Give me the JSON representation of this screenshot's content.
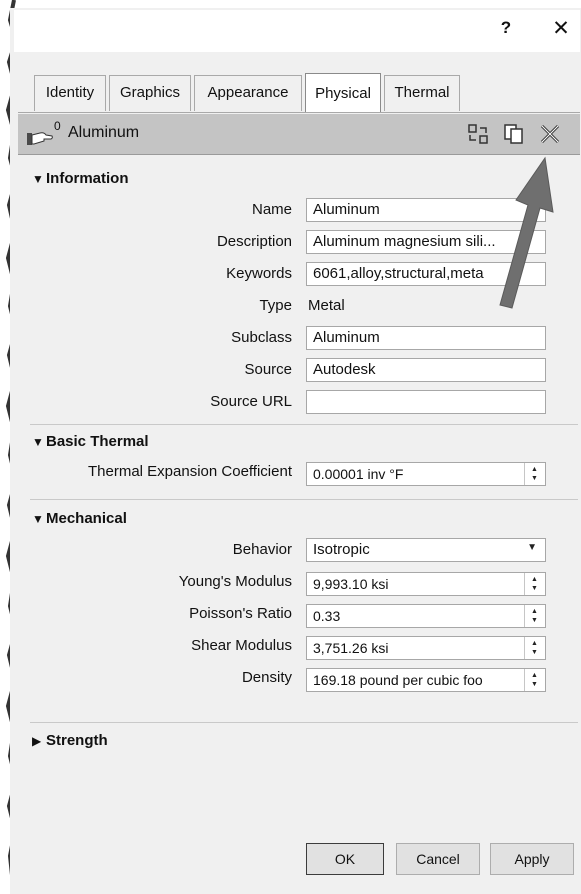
{
  "titlebar": {
    "help_label": "?",
    "close_label": "✕"
  },
  "tabs": [
    {
      "label": "Identity"
    },
    {
      "label": "Graphics"
    },
    {
      "label": "Appearance"
    },
    {
      "label": "Physical"
    },
    {
      "label": "Thermal"
    }
  ],
  "active_tab": "Physical",
  "material": {
    "count": "0",
    "name": "Aluminum",
    "icons": [
      "replace-asset-icon",
      "duplicate-asset-icon",
      "remove-asset-icon"
    ]
  },
  "information": {
    "heading": "Information",
    "name_label": "Name",
    "name_value": "Aluminum",
    "description_label": "Description",
    "description_value": "Aluminum magnesium sili...",
    "keywords_label": "Keywords",
    "keywords_value": "6061,alloy,structural,meta",
    "type_label": "Type",
    "type_value": "Metal",
    "subclass_label": "Subclass",
    "subclass_value": "Aluminum",
    "source_label": "Source",
    "source_value": "Autodesk",
    "source_url_label": "Source URL",
    "source_url_value": ""
  },
  "basic_thermal": {
    "heading": "Basic Thermal",
    "expansion_label": "Thermal Expansion Coefficient",
    "expansion_value": "0.00001 inv °F"
  },
  "mechanical": {
    "heading": "Mechanical",
    "behavior_label": "Behavior",
    "behavior_value": "Isotropic",
    "youngs_label": "Young's Modulus",
    "youngs_value": "9,993.10 ksi",
    "poisson_label": "Poisson's Ratio",
    "poisson_value": "0.33",
    "shear_label": "Shear Modulus",
    "shear_value": "3,751.26 ksi",
    "density_label": "Density",
    "density_value": "169.18 pound per cubic foo"
  },
  "strength": {
    "heading": "Strength"
  },
  "footer": {
    "ok_label": "OK",
    "cancel_label": "Cancel",
    "apply_label": "Apply"
  },
  "colors": {
    "header_bar": "#c4c4c4",
    "dialog_bg": "#f0f0f0",
    "annotation_arrow": "#6f6f6f"
  }
}
